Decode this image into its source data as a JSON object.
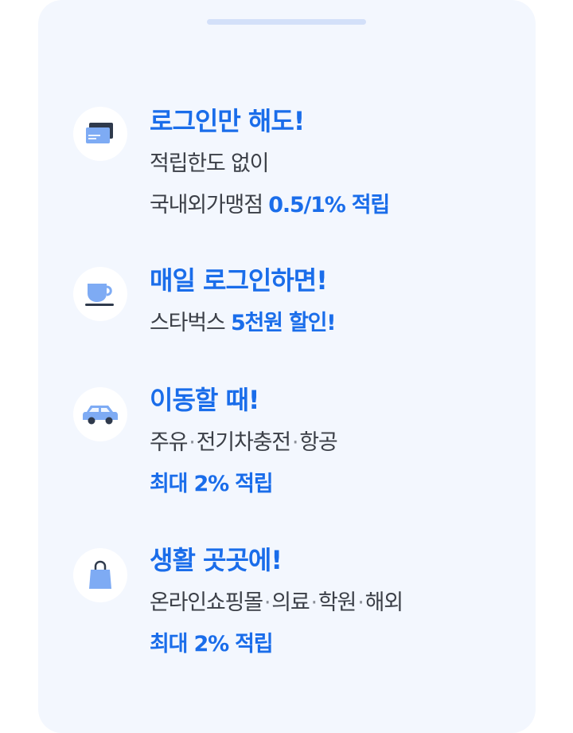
{
  "benefits": [
    {
      "icon": "credit-card-icon",
      "title": "로그인만 해도!",
      "line1": "적립한도 없이",
      "line2_prefix": "국내외가맹점",
      "line2_highlight": "0.5/1% 적립"
    },
    {
      "icon": "coffee-cup-icon",
      "title": "매일 로그인하면!",
      "line1_prefix": "스타벅스",
      "line1_highlight": "5천원 할인!"
    },
    {
      "icon": "car-icon",
      "title": "이동할 때!",
      "line1_items": [
        "주유",
        "전기차충전",
        "항공"
      ],
      "line2_highlight": "최대 2% 적립"
    },
    {
      "icon": "shopping-bag-icon",
      "title": "생활 곳곳에!",
      "line1_items": [
        "온라인쇼핑몰",
        "의료",
        "학원",
        "해외"
      ],
      "line2_highlight": "최대 2% 적립"
    }
  ],
  "separator": "·",
  "colors": {
    "accent": "#1a6dea",
    "sheet_bg": "#f3f7fe",
    "handle": "#d3e0f9",
    "icon_blue": "#7eabf4",
    "icon_dark": "#2f3a4c",
    "text": "#3b3f47"
  }
}
